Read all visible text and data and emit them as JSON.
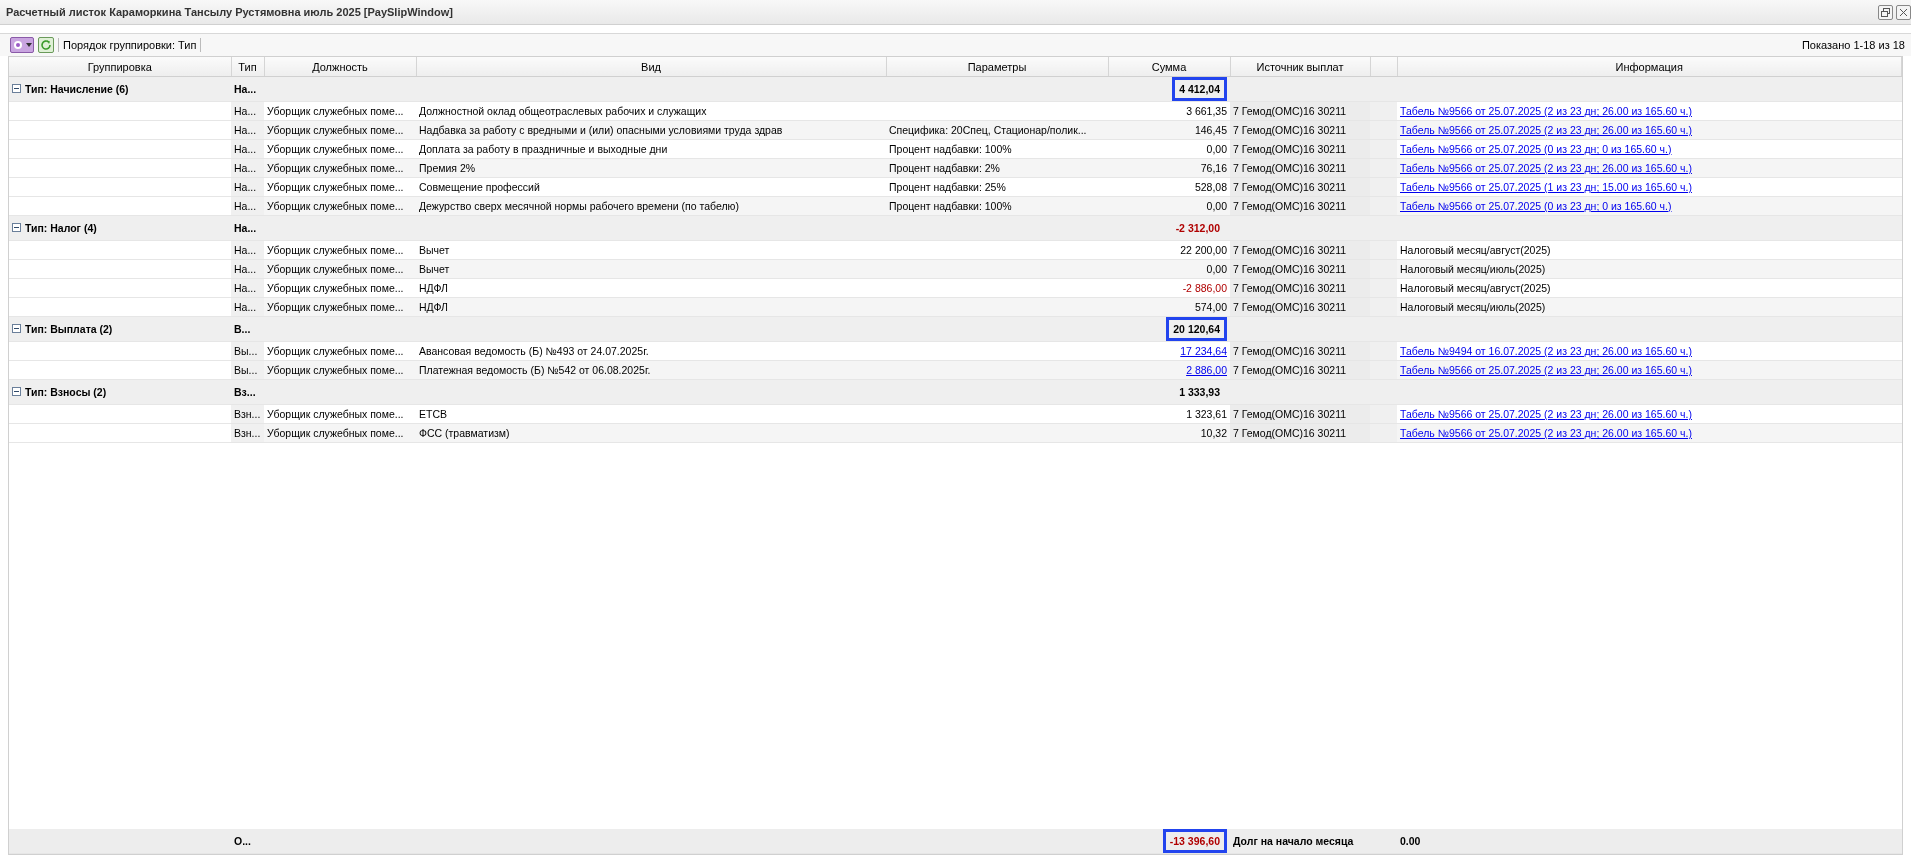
{
  "window": {
    "title": "Расчетный листок Караморкина Тансылу Рустямовна июль 2025 [PaySlipWindow]"
  },
  "toolbar": {
    "grouping_label": "Порядок группировки: Тип",
    "paging": "Показано 1-18 из 18"
  },
  "columns": [
    "Группировка",
    "Тип",
    "Должность",
    "Вид",
    "Параметры",
    "Сумма",
    "Источник выплат",
    "Информация"
  ],
  "groups": [
    {
      "label": "Тип: Начисление (6)",
      "type": "На...",
      "total": "4 412,04",
      "negative": false,
      "highlighted": true,
      "expanded": true,
      "rows": [
        {
          "type": "На...",
          "position": "Уборщик служебных поме...",
          "kind": "Должностной оклад общеотраслевых рабочих и служащих",
          "params": "",
          "amount": "3 661,35",
          "negative": false,
          "amount_link": false,
          "source": "7 Гемод(ОМС)16 30211",
          "info": "Табель №9566 от 25.07.2025 (2 из 23 дн; 26.00 из 165.60 ч.)",
          "info_link": true
        },
        {
          "type": "На...",
          "position": "Уборщик служебных поме...",
          "kind": "Надбавка за работу с вредными и (или) опасными условиями труда здрав",
          "params": "Специфика: 20Спец, Стационар/полик...",
          "amount": "146,45",
          "negative": false,
          "amount_link": false,
          "source": "7 Гемод(ОМС)16 30211",
          "info": "Табель №9566 от 25.07.2025 (2 из 23 дн; 26.00 из 165.60 ч.)",
          "info_link": true
        },
        {
          "type": "На...",
          "position": "Уборщик служебных поме...",
          "kind": "Доплата за работу в праздничные и выходные дни",
          "params": "Процент надбавки: 100%",
          "amount": "0,00",
          "negative": false,
          "amount_link": false,
          "source": "7 Гемод(ОМС)16 30211",
          "info": "Табель №9566 от 25.07.2025 (0 из 23 дн; 0 из 165.60 ч.)",
          "info_link": true
        },
        {
          "type": "На...",
          "position": "Уборщик служебных поме...",
          "kind": "Премия 2%",
          "params": "Процент надбавки: 2%",
          "amount": "76,16",
          "negative": false,
          "amount_link": false,
          "source": "7 Гемод(ОМС)16 30211",
          "info": "Табель №9566 от 25.07.2025 (2 из 23 дн; 26.00 из 165.60 ч.)",
          "info_link": true
        },
        {
          "type": "На...",
          "position": "Уборщик служебных поме...",
          "kind": "Совмещение профессий",
          "params": "Процент надбавки: 25%",
          "amount": "528,08",
          "negative": false,
          "amount_link": false,
          "source": "7 Гемод(ОМС)16 30211",
          "info": "Табель №9566 от 25.07.2025 (1 из 23 дн; 15.00 из 165.60 ч.)",
          "info_link": true
        },
        {
          "type": "На...",
          "position": "Уборщик служебных поме...",
          "kind": "Дежурство сверх месячной нормы рабочего времени (по табелю)",
          "params": "Процент надбавки: 100%",
          "amount": "0,00",
          "negative": false,
          "amount_link": false,
          "source": "7 Гемод(ОМС)16 30211",
          "info": "Табель №9566 от 25.07.2025 (0 из 23 дн; 0 из 165.60 ч.)",
          "info_link": true
        }
      ]
    },
    {
      "label": "Тип: Налог (4)",
      "type": "На...",
      "total": "-2 312,00",
      "negative": true,
      "highlighted": false,
      "expanded": true,
      "rows": [
        {
          "type": "На...",
          "position": "Уборщик служебных поме...",
          "kind": "Вычет",
          "params": "",
          "amount": "22 200,00",
          "negative": false,
          "amount_link": false,
          "source": "7 Гемод(ОМС)16 30211",
          "info": "Налоговый месяц/август(2025)",
          "info_link": false
        },
        {
          "type": "На...",
          "position": "Уборщик служебных поме...",
          "kind": "Вычет",
          "params": "",
          "amount": "0,00",
          "negative": false,
          "amount_link": false,
          "source": "7 Гемод(ОМС)16 30211",
          "info": "Налоговый месяц/июль(2025)",
          "info_link": false
        },
        {
          "type": "На...",
          "position": "Уборщик служебных поме...",
          "kind": "НДФЛ",
          "params": "",
          "amount": "-2 886,00",
          "negative": true,
          "amount_link": false,
          "source": "7 Гемод(ОМС)16 30211",
          "info": "Налоговый месяц/август(2025)",
          "info_link": false
        },
        {
          "type": "На...",
          "position": "Уборщик служебных поме...",
          "kind": "НДФЛ",
          "params": "",
          "amount": "574,00",
          "negative": false,
          "amount_link": false,
          "source": "7 Гемод(ОМС)16 30211",
          "info": "Налоговый месяц/июль(2025)",
          "info_link": false
        }
      ]
    },
    {
      "label": "Тип: Выплата (2)",
      "type": "В...",
      "total": "20 120,64",
      "negative": false,
      "highlighted": true,
      "expanded": true,
      "rows": [
        {
          "type": "Вы...",
          "position": "Уборщик служебных поме...",
          "kind": "Авансовая ведомость (Б) №493 от 24.07.2025г.",
          "params": "",
          "amount": "17 234,64",
          "negative": false,
          "amount_link": true,
          "source": "7 Гемод(ОМС)16 30211",
          "info": "Табель №9494 от 16.07.2025 (2 из 23 дн; 26.00 из 165.60 ч.)",
          "info_link": true
        },
        {
          "type": "Вы...",
          "position": "Уборщик служебных поме...",
          "kind": "Платежная ведомость (Б) №542 от 06.08.2025г.",
          "params": "",
          "amount": "2 886,00",
          "negative": false,
          "amount_link": true,
          "source": "7 Гемод(ОМС)16 30211",
          "info": "Табель №9566 от 25.07.2025 (2 из 23 дн; 26.00 из 165.60 ч.)",
          "info_link": true
        }
      ]
    },
    {
      "label": "Тип: Взносы (2)",
      "type": "Вз...",
      "total": "1 333,93",
      "negative": false,
      "highlighted": false,
      "expanded": true,
      "rows": [
        {
          "type": "Взн...",
          "position": "Уборщик служебных поме...",
          "kind": "ЕТСВ",
          "params": "",
          "amount": "1 323,61",
          "negative": false,
          "amount_link": false,
          "source": "7 Гемод(ОМС)16 30211",
          "info": "Табель №9566 от 25.07.2025 (2 из 23 дн; 26.00 из 165.60 ч.)",
          "info_link": true
        },
        {
          "type": "Взн...",
          "position": "Уборщик служебных поме...",
          "kind": "ФСС (травматизм)",
          "params": "",
          "amount": "10,32",
          "negative": false,
          "amount_link": false,
          "source": "7 Гемод(ОМС)16 30211",
          "info": "Табель №9566 от 25.07.2025 (2 из 23 дн; 26.00 из 165.60 ч.)",
          "info_link": true
        }
      ]
    }
  ],
  "footer": {
    "type": "О...",
    "total": "-13 396,60",
    "negative": true,
    "highlighted": true,
    "label": "Долг на начало месяца",
    "value": "0.00"
  }
}
